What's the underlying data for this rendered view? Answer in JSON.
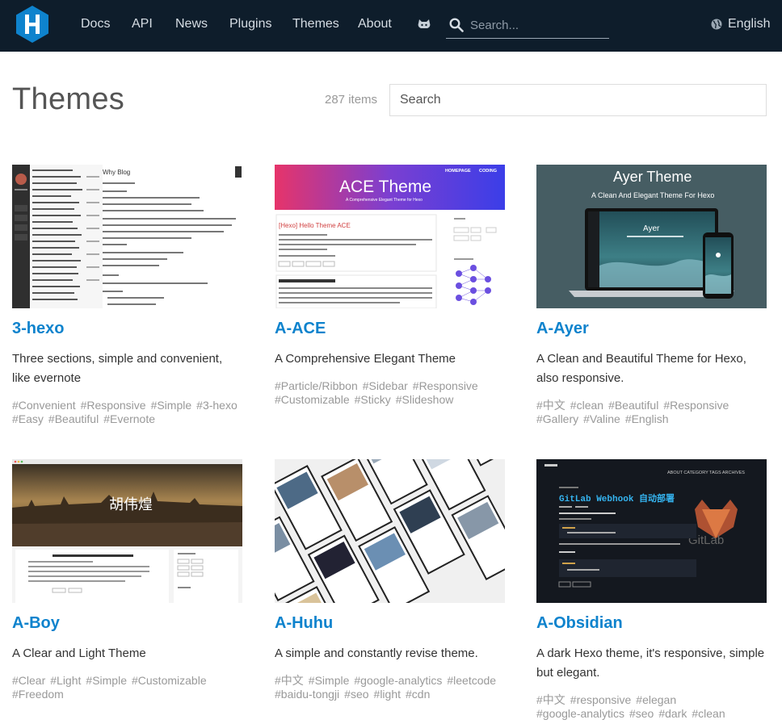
{
  "nav": {
    "items": [
      "Docs",
      "API",
      "News",
      "Plugins",
      "Themes",
      "About"
    ],
    "search_placeholder": "Search...",
    "language": "English"
  },
  "page": {
    "title": "Themes",
    "count": "287 items",
    "search_placeholder": "Search"
  },
  "themes": [
    {
      "name": "3-hexo",
      "description": "Three sections, simple and convenient, like evernote",
      "tags": [
        "#Convenient",
        "#Responsive",
        "#Simple",
        "#3-hexo",
        "#Easy",
        "#Beautiful",
        "#Evernote"
      ],
      "preview": {
        "heading": "Why Blog"
      }
    },
    {
      "name": "A-ACE",
      "description": "A Comprehensive Elegant Theme",
      "tags": [
        "#Particle/Ribbon",
        "#Sidebar",
        "#Responsive",
        "#Customizable",
        "#Sticky",
        "#Slideshow"
      ],
      "preview": {
        "heading": "ACE Theme",
        "subheading": "A Comprehensive Elegant Theme for Hexo",
        "nav1": "HOMEPAGE",
        "nav2": "CODING",
        "post_title": "[Hexo] Hello Theme ACE"
      }
    },
    {
      "name": "A-Ayer",
      "description": "A Clean and Beautiful Theme for Hexo, also responsive.",
      "tags": [
        "#中文",
        "#clean",
        "#Beautiful",
        "#Responsive",
        "#Gallery",
        "#Valine",
        "#English"
      ],
      "preview": {
        "heading": "Ayer Theme",
        "subheading": "A Clean And Elegant Theme For Hexo",
        "laptop_title": "Ayer"
      }
    },
    {
      "name": "A-Boy",
      "description": "A Clear and Light Theme",
      "tags": [
        "#Clear",
        "#Light",
        "#Simple",
        "#Customizable",
        "#Freedom"
      ],
      "preview": {
        "heading": "胡伟煌"
      }
    },
    {
      "name": "A-Huhu",
      "description": "A simple and constantly revise theme.",
      "tags": [
        "#中文",
        "#Simple",
        "#google-analytics",
        "#leetcode",
        "#baidu-tongji",
        "#seo",
        "#light",
        "#cdn"
      ],
      "preview": {}
    },
    {
      "name": "A-Obsidian",
      "description": "A dark Hexo theme, it's responsive, simple but elegant.",
      "tags": [
        "#中文",
        "#responsive",
        "#elegan",
        "#google-analytics",
        "#seo",
        "#dark",
        "#clean"
      ],
      "preview": {
        "heading": "GitLab Webhook 自动部署",
        "nav": "ABOUT  CATEGORY  TAGS  ARCHIVES",
        "watermark": "GitLab"
      }
    }
  ],
  "colors": {
    "header_bg": "#0e1d2b",
    "link": "#0e83cd",
    "tag": "#999999",
    "logo": "#0e83cd"
  }
}
